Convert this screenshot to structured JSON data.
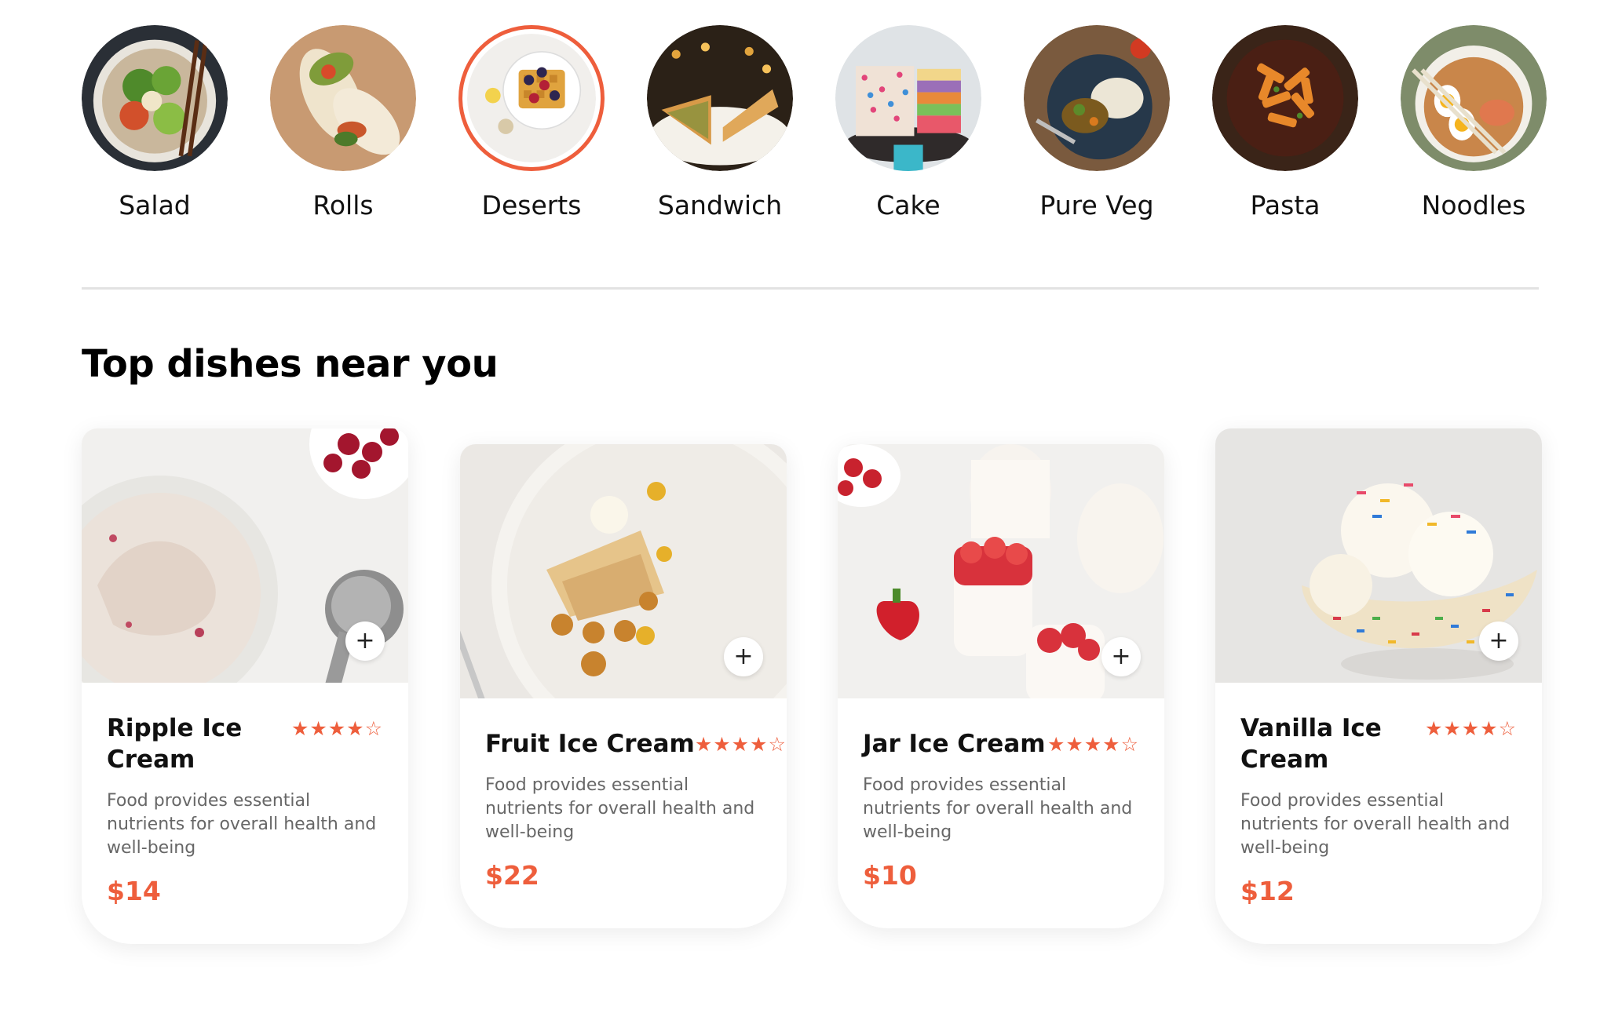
{
  "categories": [
    {
      "label": "Salad",
      "icon": "salad-image"
    },
    {
      "label": "Rolls",
      "icon": "rolls-image"
    },
    {
      "label": "Deserts",
      "icon": "deserts-image",
      "active": true
    },
    {
      "label": "Sandwich",
      "icon": "sandwich-image"
    },
    {
      "label": "Cake",
      "icon": "cake-image"
    },
    {
      "label": "Pure Veg",
      "icon": "pure-veg-image"
    },
    {
      "label": "Pasta",
      "icon": "pasta-image"
    },
    {
      "label": "Noodles",
      "icon": "noodles-image"
    }
  ],
  "section": {
    "title": "Top dishes near you"
  },
  "dishes": [
    {
      "name": "Ripple Ice Cream",
      "rating": 4,
      "rating_max": 5,
      "description": "Food provides essential nutrients for overall health and well-being",
      "price": "$14"
    },
    {
      "name": "Fruit Ice Cream",
      "rating": 4,
      "rating_max": 5,
      "description": "Food provides essential nutrients for overall health and well-being",
      "price": "$22"
    },
    {
      "name": "Jar Ice Cream",
      "rating": 4,
      "rating_max": 5,
      "description": "Food provides essential nutrients for overall health and well-being",
      "price": "$10"
    },
    {
      "name": "Vanilla Ice Cream",
      "rating": 4,
      "rating_max": 5,
      "description": "Food provides essential nutrients for overall health and well-being",
      "price": "$12"
    }
  ],
  "add_label": "+",
  "colors": {
    "accent": "#ee5e3c",
    "divider": "#e2e2e2",
    "text_muted": "#676767"
  }
}
